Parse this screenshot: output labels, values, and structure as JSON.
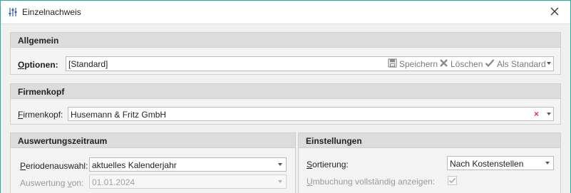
{
  "window": {
    "title": "Einzelnachweis",
    "title_icon": "sliders-icon",
    "close_icon": "close-icon"
  },
  "allgemein": {
    "header": "Allgemein",
    "options_label_prefix": "O",
    "options_label_rest": "ptionen:",
    "options_value": "[Standard]",
    "save_label": "Speichern",
    "delete_label": "Löschen",
    "default_label": "Als Standard"
  },
  "firmenkopf": {
    "header": "Firmenkopf",
    "label_prefix": "F",
    "label_rest": "irmenkopf:",
    "value": "Husemann & Fritz GmbH",
    "clear_symbol": "×"
  },
  "auswertungszeitraum": {
    "header": "Auswertungszeitraum",
    "period_label_prefix": "P",
    "period_label_rest": "eriodenauswahl:",
    "period_value": "aktuelles Kalenderjahr",
    "from_label_prefix": "Auswertung ",
    "from_label_u": "v",
    "from_label_rest": "on:",
    "from_value": "01.01.2024"
  },
  "einstellungen": {
    "header": "Einstellungen",
    "sort_label_prefix": "S",
    "sort_label_rest": "ortierung:",
    "sort_value": "Nach Kostenstellen",
    "rebook_label_prefix": "U",
    "rebook_label_rest": "mbuchung vollständig anzeigen:",
    "rebook_checked": true
  }
}
